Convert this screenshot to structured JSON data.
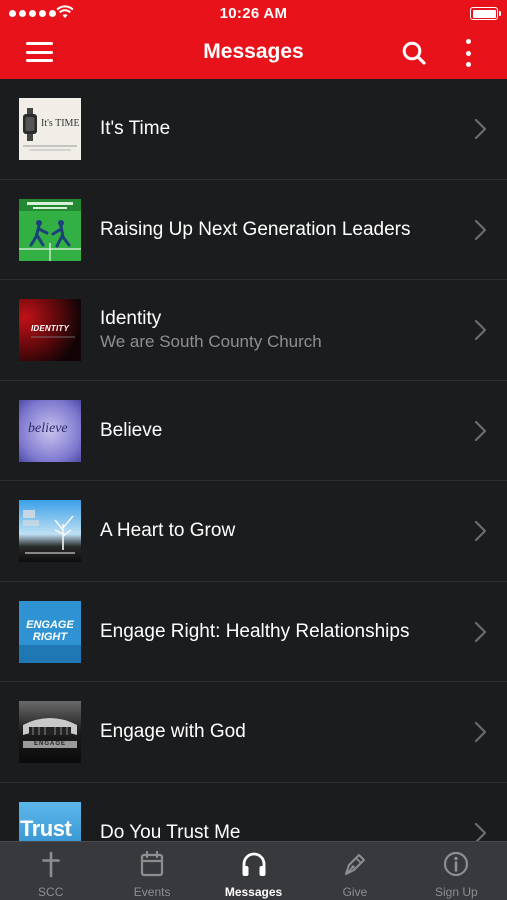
{
  "status_bar": {
    "time": "10:26 AM"
  },
  "header": {
    "title": "Messages"
  },
  "messages": [
    {
      "title": "It's Time",
      "subtitle": "",
      "thumb_text": "It's TIME"
    },
    {
      "title": "Raising Up Next Generation Leaders",
      "subtitle": "",
      "thumb_text": ""
    },
    {
      "title": "Identity",
      "subtitle": "We are South County Church",
      "thumb_text": "IDENTITY"
    },
    {
      "title": "Believe",
      "subtitle": "",
      "thumb_text": "believe"
    },
    {
      "title": "A Heart to Grow",
      "subtitle": "",
      "thumb_text": ""
    },
    {
      "title": "Engage Right: Healthy Relationships",
      "subtitle": "",
      "thumb_text": "ENGAGE RIGHT"
    },
    {
      "title": "Engage with God",
      "subtitle": "",
      "thumb_text": "ENGAGE"
    },
    {
      "title": "Do You Trust Me",
      "subtitle": "",
      "thumb_text": "Trust"
    }
  ],
  "tabs": [
    {
      "label": "SCC",
      "icon": "cross-icon",
      "active": false
    },
    {
      "label": "Events",
      "icon": "calendar-icon",
      "active": false
    },
    {
      "label": "Messages",
      "icon": "headphones-icon",
      "active": true
    },
    {
      "label": "Give",
      "icon": "pen-icon",
      "active": false
    },
    {
      "label": "Sign Up",
      "icon": "info-icon",
      "active": false
    }
  ],
  "colors": {
    "header_red": "#e8131a",
    "list_background": "#1b1c1e",
    "tabbar_background": "#38393c",
    "subtitle_gray": "#8e8e93"
  }
}
